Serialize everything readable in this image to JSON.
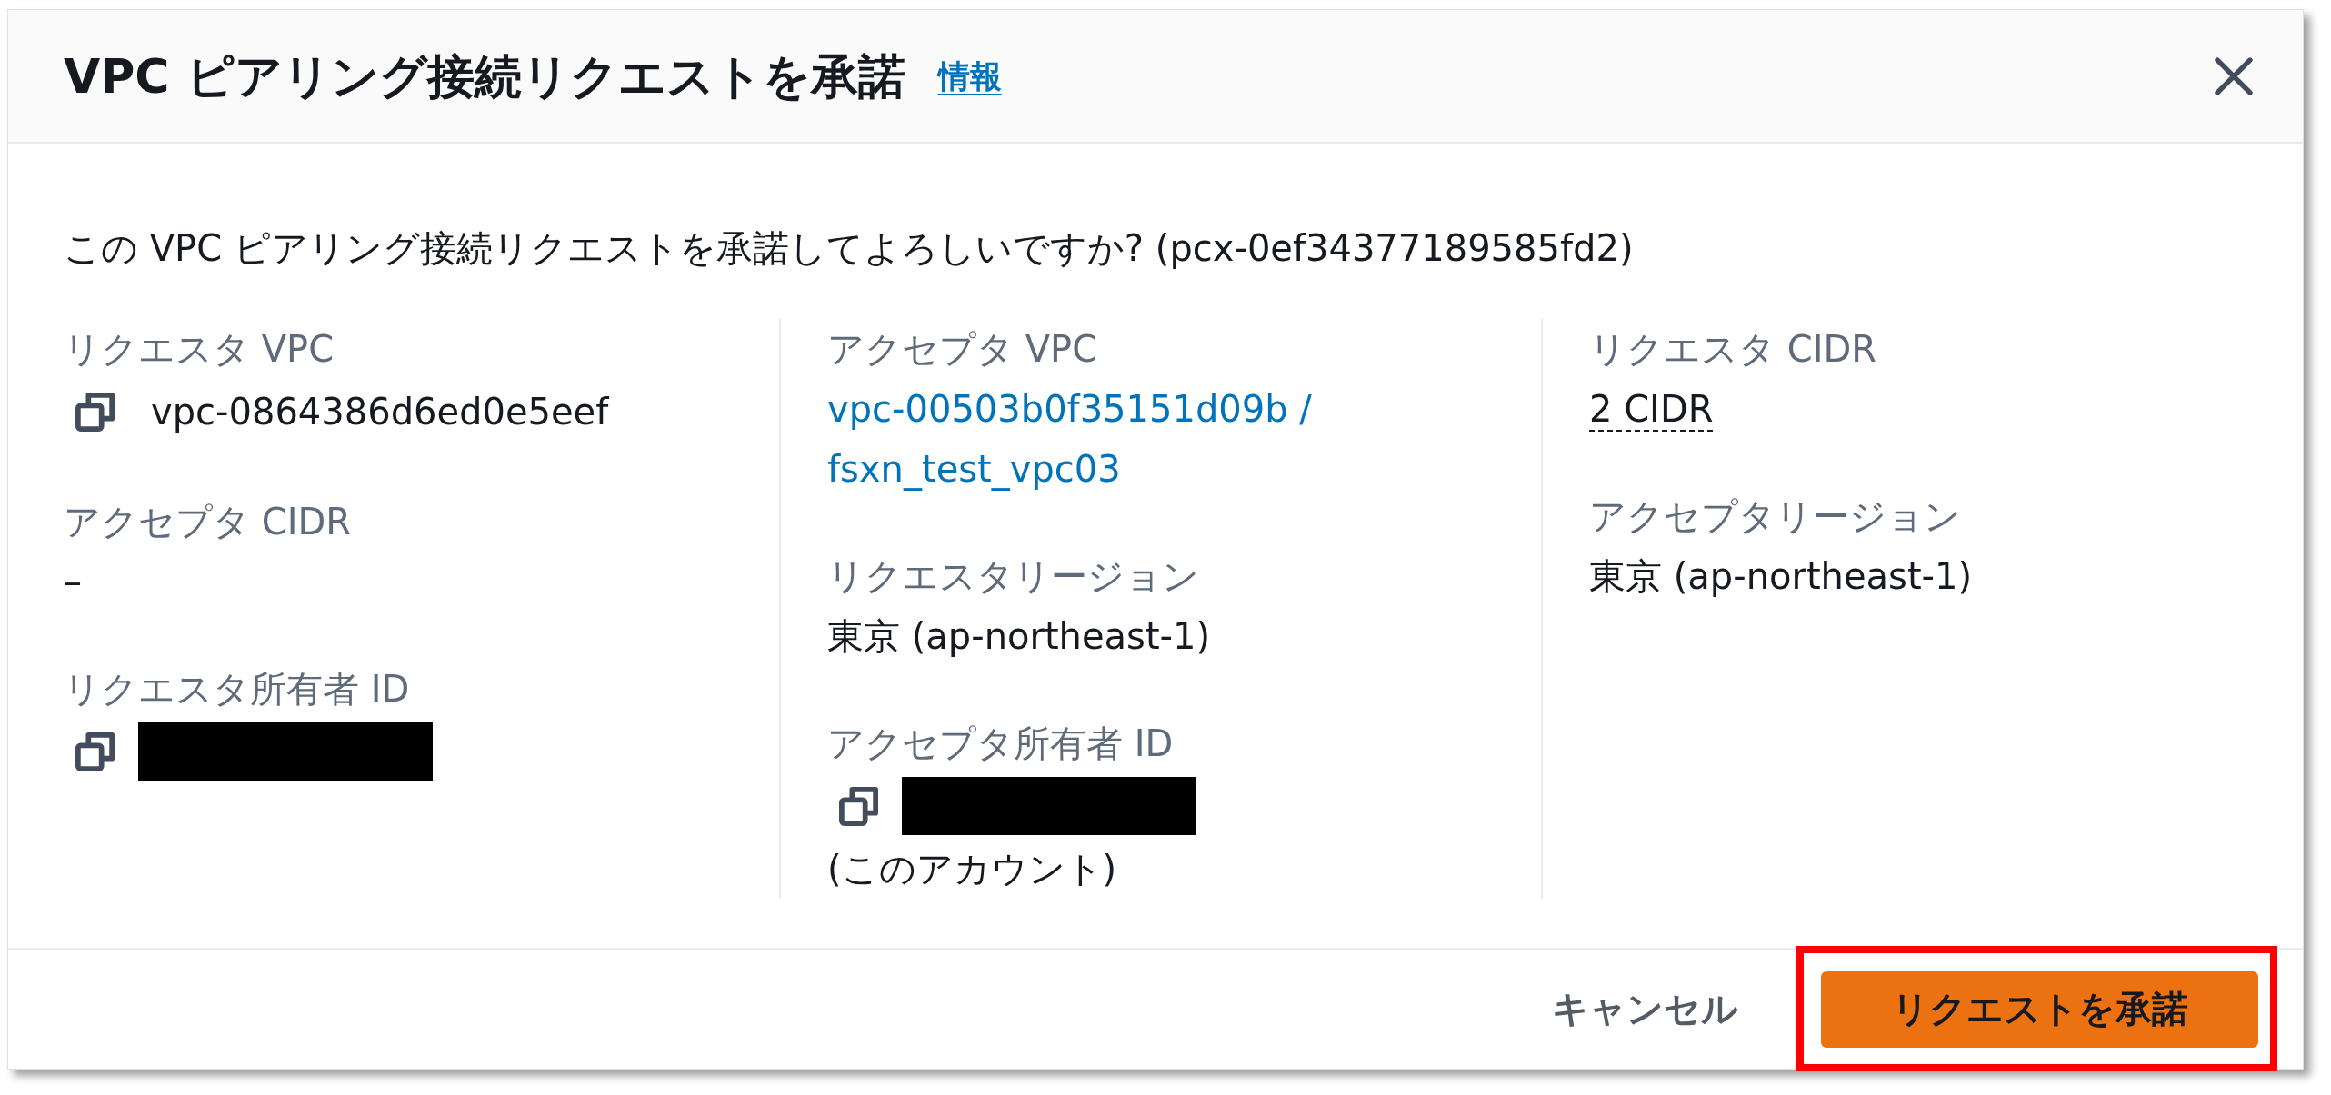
{
  "modal": {
    "title": "VPC ピアリング接続リクエストを承諾",
    "info_link": "情報"
  },
  "body": {
    "question": "この VPC ピアリング接続リクエストを承諾してよろしいですか? (pcx-0ef34377189585fd2)",
    "columns": [
      {
        "fields": [
          {
            "label": "リクエスタ VPC",
            "kind": "copy",
            "value": "vpc-0864386d6ed0e5eef"
          },
          {
            "label": "アクセプタ CIDR",
            "kind": "text",
            "value": "–"
          },
          {
            "label": "リクエスタ所有者 ID",
            "kind": "copy_redacted"
          }
        ]
      },
      {
        "fields": [
          {
            "label": "アクセプタ VPC",
            "kind": "link",
            "value": "vpc-00503b0f35151d09b / fsxn_test_vpc03"
          },
          {
            "label": "リクエスタリージョン",
            "kind": "text",
            "value": "東京 (ap-northeast-1)"
          },
          {
            "label": "アクセプタ所有者 ID",
            "kind": "copy_redacted",
            "note": "(このアカウント)"
          }
        ]
      },
      {
        "fields": [
          {
            "label": "リクエスタ CIDR",
            "kind": "popover",
            "value": "2 CIDR"
          },
          {
            "label": "アクセプタリージョン",
            "kind": "text",
            "value": "東京 (ap-northeast-1)"
          }
        ]
      }
    ]
  },
  "footer": {
    "buttons": [
      {
        "label": "キャンセル",
        "kind": "link",
        "highlighted": false
      },
      {
        "label": "リクエストを承諾",
        "kind": "primary",
        "highlighted": true
      }
    ]
  }
}
